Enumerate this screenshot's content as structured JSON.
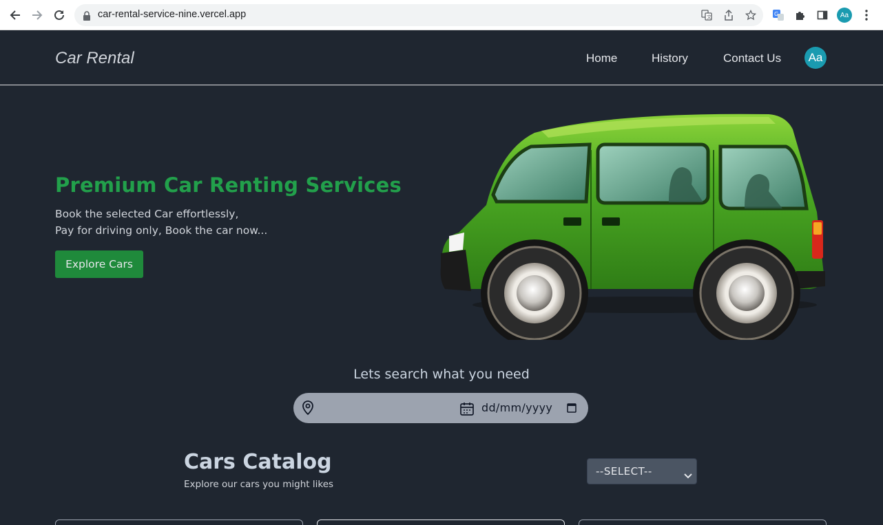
{
  "browser": {
    "url": "car-rental-service-nine.vercel.app",
    "profile_initials": "Aa",
    "icons": [
      "back-icon",
      "forward-icon",
      "reload-icon",
      "lock-icon",
      "translate-icon",
      "share-icon",
      "star-icon",
      "google-translate-extension-icon",
      "puzzle-icon",
      "side-panel-icon",
      "menu-icon"
    ]
  },
  "header": {
    "brand": "Car Rental",
    "nav": [
      "Home",
      "History",
      "Contact Us"
    ],
    "avatar": "Aa"
  },
  "hero": {
    "title": "Premium Car Renting Services",
    "subtitle_line1": "Book the selected Car effortlessly,",
    "subtitle_line2": "Pay for driving only, Book the car now...",
    "button": "Explore Cars"
  },
  "search": {
    "heading": "Lets search what you need",
    "location_placeholder": "",
    "date_placeholder": "dd/mm/yyyy"
  },
  "catalog": {
    "title": "Cars Catalog",
    "subtitle": "Explore our cars you might likes",
    "select_value": "--SELECT--"
  },
  "colors": {
    "background": "#1f2630",
    "accent_green": "#22a04b",
    "button_green": "#1f8a3b",
    "avatar_teal": "#1a9bb0",
    "search_bar": "#9ca3af"
  }
}
